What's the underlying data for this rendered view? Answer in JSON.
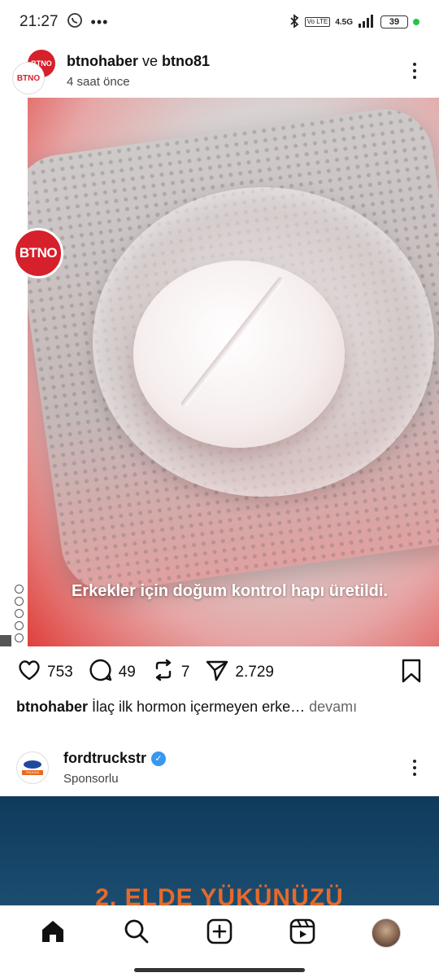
{
  "status_bar": {
    "time": "21:27",
    "network": "4.5G",
    "volte": "Vo LTE",
    "battery": "39"
  },
  "post": {
    "author1": "btnohaber",
    "connector": "ve",
    "author2": "btno81",
    "time": "4 saat önce",
    "avatar_text": "BTNO",
    "image_logo": "BTNO",
    "image_caption": "Erkekler için doğum kontrol hapı üretildi.",
    "likes": "753",
    "comments": "49",
    "reposts": "7",
    "shares": "2.729",
    "caption_user": "btnohaber",
    "caption_text": "İlaç ilk hormon içermeyen erke…",
    "caption_more": "devamı"
  },
  "post2": {
    "author": "fordtruckstr",
    "sponsored": "Sponsorlu",
    "avatar_text": "TRUCKS",
    "image_text": "2. ELDE YÜKÜNÜZÜ"
  },
  "colors": {
    "brand_red": "#d6202c",
    "verified_blue": "#3897f0",
    "ford_orange": "#e7692a"
  }
}
